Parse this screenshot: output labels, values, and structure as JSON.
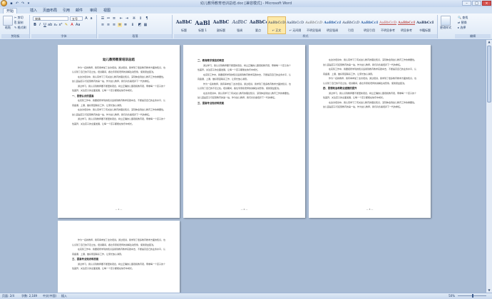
{
  "window": {
    "title": "幼儿教师教育培训总结.doc [兼容模式] - Microsoft Word",
    "controls": [
      "–",
      "□",
      "×"
    ]
  },
  "quick_access": [
    "save-icon",
    "undo-icon",
    "redo-icon",
    "customize-icon"
  ],
  "tabs": [
    "开始",
    "插入",
    "页面布局",
    "引用",
    "邮件",
    "审阅",
    "视图"
  ],
  "ribbon": {
    "clipboard": {
      "paste": "粘贴",
      "cut": "剪切",
      "copy": "复制",
      "format_painter": "格式刷",
      "label": "剪贴板"
    },
    "font": {
      "name": "宋体",
      "size": "五号",
      "label": "字体"
    },
    "paragraph": {
      "label": "段落"
    },
    "styles": {
      "items": [
        {
          "sample": "AaBbC",
          "name": "标题"
        },
        {
          "sample": "AaBl",
          "name": "标题 1"
        },
        {
          "sample": "AaBbC",
          "name": "副标题"
        },
        {
          "sample": "AaBbC",
          "name": "强调"
        },
        {
          "sample": "AaBbCcD",
          "name": "要点"
        },
        {
          "sample": "AaBbCcDc",
          "name": "↵ 正文"
        },
        {
          "sample": "AaBbCcDc",
          "name": "↵ 无间隔"
        },
        {
          "sample": "AaBbCcDc",
          "name": "不明显强调"
        },
        {
          "sample": "AaBbCcDc",
          "name": "明显强调"
        },
        {
          "sample": "AaBbCcDc",
          "name": "引用"
        },
        {
          "sample": "AaBbCcDc",
          "name": "明显引用"
        },
        {
          "sample": "AaBbCcDc",
          "name": "不明显参考"
        },
        {
          "sample": "AaBbCcDc",
          "name": "明显参考"
        },
        {
          "sample": "AaBbCcDc",
          "name": "书籍标题"
        }
      ],
      "label": "样式",
      "change_styles": "更改样式"
    },
    "editing": {
      "find": "查找",
      "replace": "替换",
      "select": "选择",
      "label": "编辑"
    }
  },
  "document": {
    "title": "幼儿教师教育培训总结",
    "headings": [
      "一、思想认识的提高",
      "二、教育教学观念的转变",
      "三、提高专业知识和技能",
      "四、思想政治和职业道德的提升"
    ],
    "paragraphs": [
      "作为一名新教师，我有幸参加了这次培训。通过培训，我学到了很多教育教学方面的知识，也认识到了自己的不足之处。培训期间，各位专家和老师的讲解生动形象，使我受益匪浅。",
      "在这次培训中，我认真学习了有关幼儿教育的理论知识，深刻体会到幼儿教育工作的重要性。幼儿园是孩子们接受教育的第一站，作为幼儿教师，我们肩负着培养下一代的重任。",
      "通过学习，我认识到教师要不断更新观念，树立正确的儿童观和教育观，尊重每一个孩子的个性差异，关注孩子的全面发展，让每一个孩子都能在快乐中成长。",
      "在实际工作中，我要把所学到的知识运用到教育教学实践中去，不断提高自己的业务水平，认真备课、上课，做好家园联系工作，让家长放心满意。"
    ],
    "page_numbers": [
      "— 1 —",
      "— 2 —",
      "— 3 —"
    ]
  },
  "status": {
    "page": "页面: 2/4",
    "words": "字数: 2,189",
    "language": "中文(中国)",
    "mode": "插入",
    "zoom": "50%"
  }
}
